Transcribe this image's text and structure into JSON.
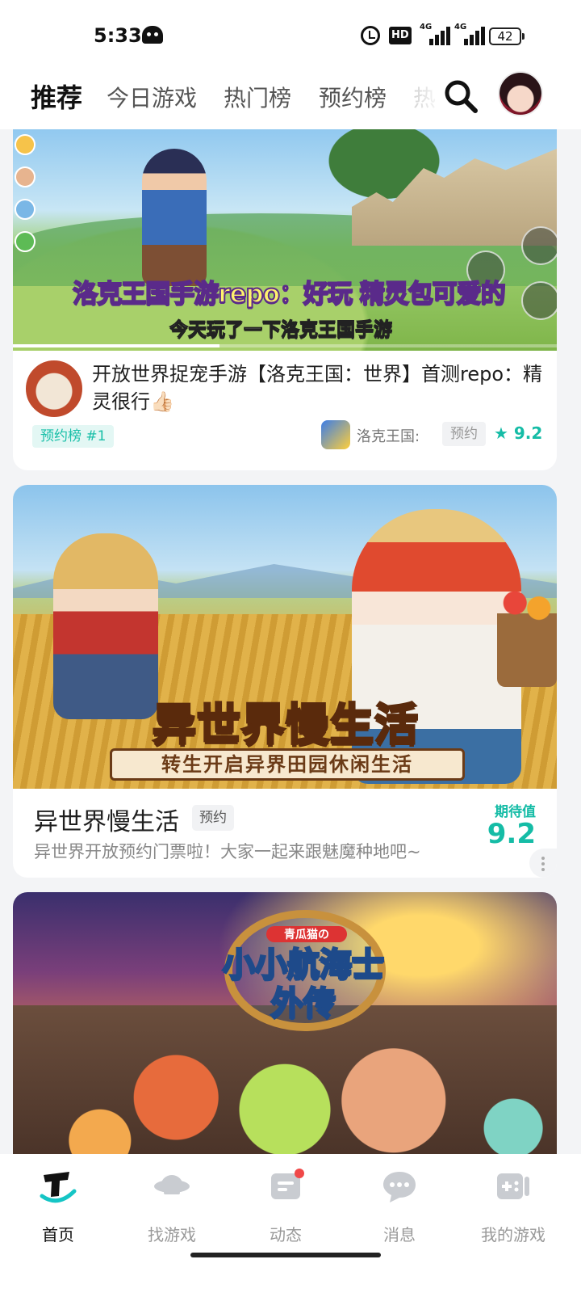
{
  "status_bar": {
    "time": "5:33",
    "hd_badge": "HD",
    "signal_1": "4G",
    "signal_2": "4G",
    "battery": "42"
  },
  "top_tabs": {
    "items": [
      "推荐",
      "今日游戏",
      "热门榜",
      "预约榜",
      "热"
    ],
    "active_index": 0,
    "accent_color": "#15c5c5"
  },
  "feed": {
    "card1": {
      "caption_main": "洛克王国手游repo：好玩 精灵包可爱的",
      "caption_sub": "今天玩了一下洛克王国手游",
      "video_progress": 0.38,
      "title": "开放世界捉宠手游【洛克王国：世界】首测repo：精灵很行👍🏻",
      "rank_badge": "预约榜 #1",
      "game_name": "洛克王国:",
      "reserve_label": "预约",
      "rating": "★ 9.2"
    },
    "card2": {
      "banner_title": "异世界慢生活",
      "banner_subtitle": "转生开启异界田园休闲生活",
      "title": "异世界慢生活",
      "reserve_label": "预约",
      "description": "异世界开放预约门票啦！大家一起来跟魅魔种地吧~",
      "expect_label": "期待值",
      "expect_value": "9.2"
    },
    "card3": {
      "logo_small": "青瓜猫の",
      "logo_line1": "小小航海士",
      "logo_line2": "外传"
    }
  },
  "bottom_nav": {
    "items": [
      {
        "label": "首页",
        "icon": "home-icon",
        "active": true
      },
      {
        "label": "找游戏",
        "icon": "planet-icon",
        "active": false
      },
      {
        "label": "动态",
        "icon": "feed-icon",
        "active": false,
        "badge": true
      },
      {
        "label": "消息",
        "icon": "message-icon",
        "active": false
      },
      {
        "label": "我的游戏",
        "icon": "gamepad-icon",
        "active": false
      }
    ],
    "badge_color": "#f04848"
  }
}
